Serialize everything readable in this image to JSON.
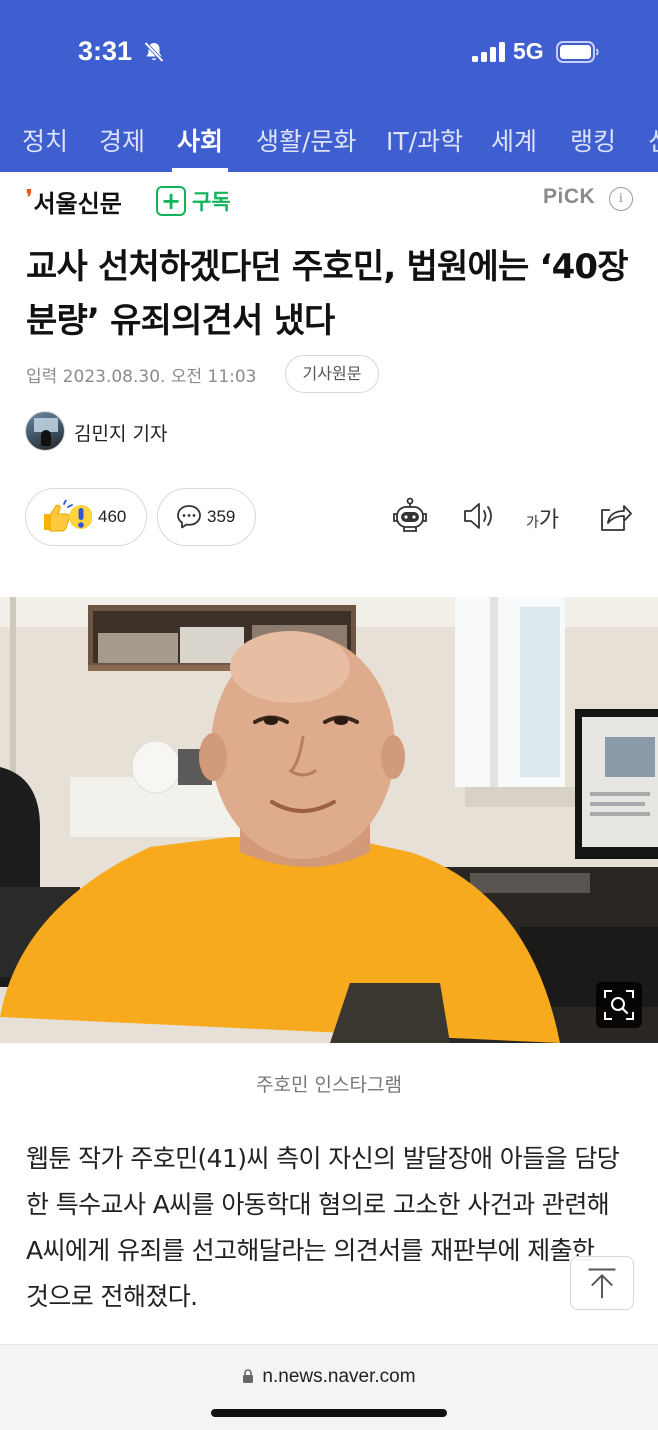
{
  "status_bar": {
    "time": "3:31",
    "network": "5G"
  },
  "nav": {
    "tabs": [
      "정치",
      "경제",
      "사회",
      "생활/문화",
      "IT/과학",
      "세계",
      "랭킹",
      "신"
    ],
    "active_index": 2,
    "bg_color": "#3f5fd1"
  },
  "publisher": {
    "name": "서울신문",
    "subscribe_label": "구독",
    "pick_label": "PiCK",
    "pick_info": "i",
    "accent_color": "#10b45a"
  },
  "article": {
    "headline": "교사 선처하겠다던 주호민, 법원에는 ‘40장 분량’ 유죄의견서 냈다",
    "date": "입력 2023.08.30. 오전 11:03",
    "original_label": "기사원문",
    "author": "김민지 기자",
    "reaction_count": "460",
    "comment_count": "359",
    "font_small": "가",
    "font_big": "가",
    "photo_caption": "주호민 인스타그램",
    "body": "웹툰 작가 주호민(41)씨 측이 자신의 발달장애 아들을 담당한 특수교사 A씨를 아동학대 혐의로 고소한 사건과 관련해 A씨에게 유죄를 선고해달라는 의견서를 재판부에 제출한 것으로 전해졌다."
  },
  "browser": {
    "url": "n.news.naver.com"
  },
  "icons": {
    "reactions": "thumbs-up-exclaim-icon",
    "comment": "comment-icon",
    "summary": "robot-icon",
    "tts": "speaker-icon",
    "font": "font-size-icon",
    "share": "share-icon",
    "zoom": "zoom-icon",
    "to_top": "arrow-up-icon"
  }
}
